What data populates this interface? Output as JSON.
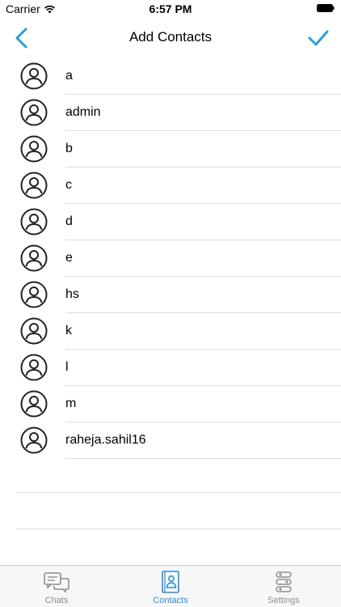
{
  "status_bar": {
    "carrier": "Carrier",
    "time": "6:57 PM"
  },
  "nav": {
    "title": "Add Contacts",
    "back_icon": "chevron-left-icon",
    "done_icon": "checkmark-icon",
    "accent": "#2a9fd6"
  },
  "contacts": [
    {
      "name": "a"
    },
    {
      "name": "admin"
    },
    {
      "name": "b"
    },
    {
      "name": "c"
    },
    {
      "name": "d"
    },
    {
      "name": "e"
    },
    {
      "name": "hs"
    },
    {
      "name": "k"
    },
    {
      "name": "l"
    },
    {
      "name": "m"
    },
    {
      "name": "raheja.sahil16"
    }
  ],
  "tabs": [
    {
      "label": "Chats",
      "icon": "chat-bubbles-icon",
      "active": false
    },
    {
      "label": "Contacts",
      "icon": "contact-book-icon",
      "active": true
    },
    {
      "label": "Settings",
      "icon": "settings-sliders-icon",
      "active": false
    }
  ]
}
